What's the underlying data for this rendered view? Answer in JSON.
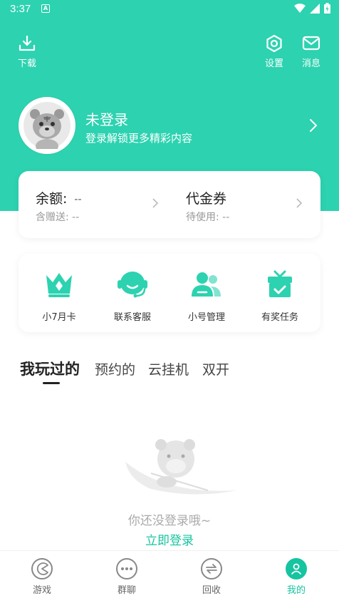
{
  "status_bar": {
    "time": "3:37",
    "notif_letter": "A"
  },
  "header": {
    "download_label": "下载",
    "settings_label": "设置",
    "messages_label": "消息"
  },
  "profile": {
    "name": "未登录",
    "subtitle": "登录解锁更多精彩内容"
  },
  "balance": {
    "balance_title": "余额:",
    "balance_value": "--",
    "gift_label": "含赠送: --",
    "voucher_title": "代金券",
    "voucher_pending": "待使用: --"
  },
  "features": [
    {
      "label": "小7月卡",
      "icon": "crown-icon"
    },
    {
      "label": "联系客服",
      "icon": "customer-service-icon"
    },
    {
      "label": "小号管理",
      "icon": "account-manage-icon"
    },
    {
      "label": "有奖任务",
      "icon": "gift-task-icon"
    }
  ],
  "tabs": [
    {
      "label": "我玩过的",
      "active": true
    },
    {
      "label": "预约的",
      "active": false
    },
    {
      "label": "云挂机",
      "active": false
    },
    {
      "label": "双开",
      "active": false
    }
  ],
  "empty_state": {
    "message": "你还没登录哦~",
    "login_link": "立即登录"
  },
  "bottom_nav": [
    {
      "label": "游戏",
      "icon": "game-icon",
      "active": false
    },
    {
      "label": "群聊",
      "icon": "chat-icon",
      "active": false
    },
    {
      "label": "回收",
      "icon": "recycle-icon",
      "active": false
    },
    {
      "label": "我的",
      "icon": "profile-icon",
      "active": true
    }
  ],
  "colors": {
    "primary": "#2dd2b0",
    "accent": "#16c4a0"
  }
}
